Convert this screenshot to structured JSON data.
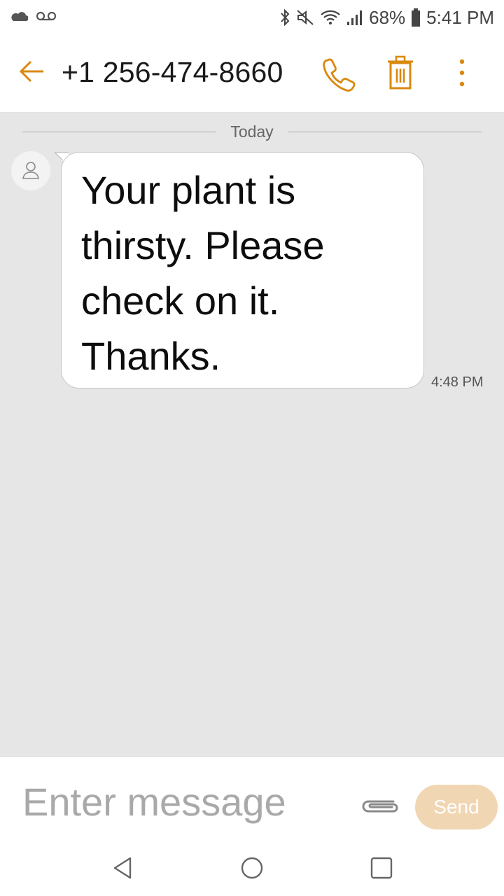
{
  "status_bar": {
    "battery": "68%",
    "time": "5:41 PM",
    "icons": [
      "cloud-icon",
      "voicemail-icon",
      "bluetooth-icon",
      "mute-icon",
      "wifi-icon",
      "signal-icon",
      "battery-icon"
    ]
  },
  "header": {
    "title": "+1 256-474-8660",
    "accent_color": "#d9890f"
  },
  "conversation": {
    "date_divider": "Today",
    "messages": [
      {
        "direction": "incoming",
        "text": "Your plant is thirsty. Please check on it. Thanks.",
        "time": "4:48 PM"
      }
    ]
  },
  "composer": {
    "placeholder": "Enter message",
    "value": "",
    "send_label": "Send",
    "send_color": "#f1d6b3"
  },
  "nav_bar": {
    "icons": [
      "nav-back-icon",
      "nav-home-icon",
      "nav-recents-icon"
    ]
  }
}
